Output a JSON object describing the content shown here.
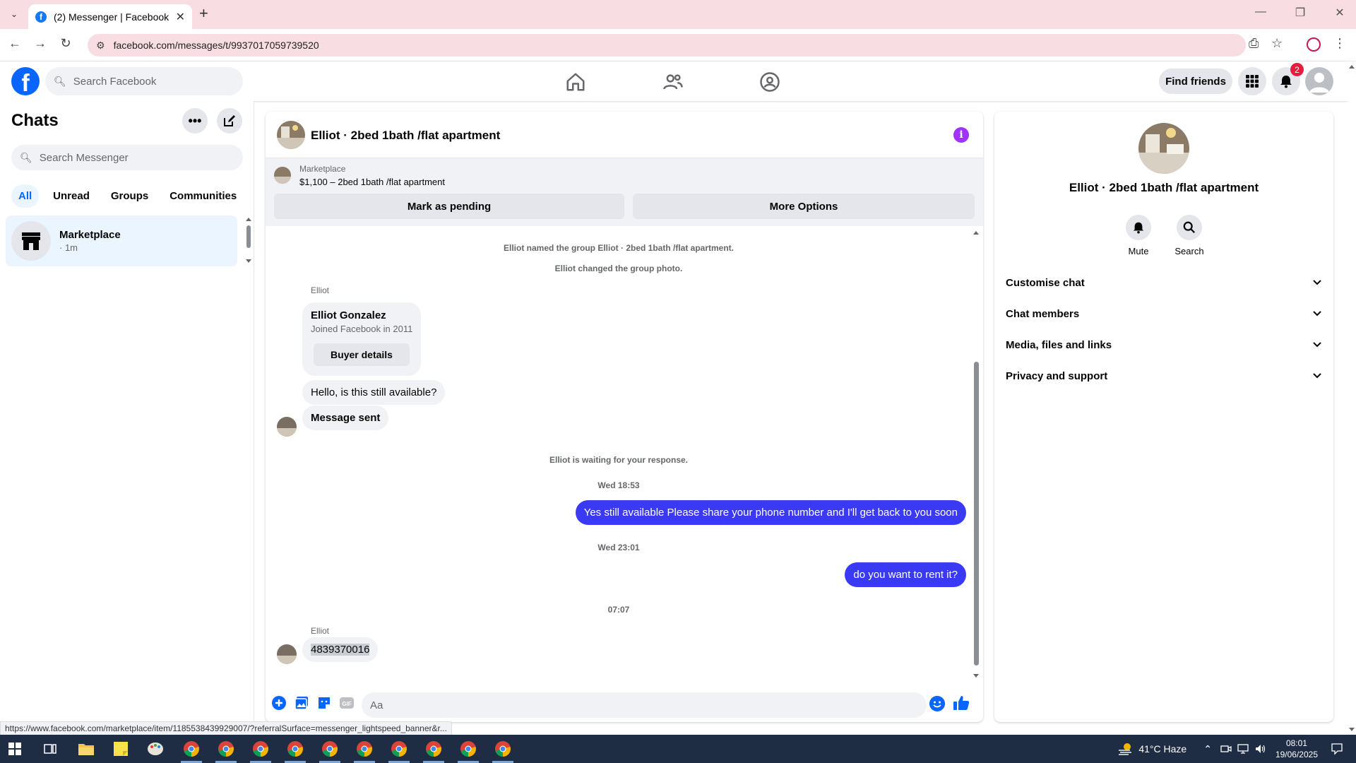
{
  "browser": {
    "tab_title": "(2) Messenger | Facebook",
    "url": "facebook.com/messages/t/9937017059739520",
    "status_link": "https://www.facebook.com/marketplace/item/1185538439929007/?referralSurface=messenger_lightspeed_banner&r..."
  },
  "header": {
    "search_placeholder": "Search Facebook",
    "find_friends_label": "Find friends",
    "notification_count": "2"
  },
  "sidebar": {
    "title": "Chats",
    "search_placeholder": "Search Messenger",
    "filters": [
      "All",
      "Unread",
      "Groups",
      "Communities"
    ],
    "active_filter": "All",
    "chats": [
      {
        "name": "Marketplace",
        "meta": "· 1m"
      }
    ]
  },
  "conversation": {
    "title": "Elliot · 2bed 1bath /flat apartment",
    "banner": {
      "label": "Marketplace",
      "price_line": "$1,100 – 2bed 1bath /flat apartment",
      "pending_label": "Mark as pending",
      "more_label": "More Options"
    },
    "system_1": "Elliot named the group Elliot · 2bed 1bath /flat apartment.",
    "system_2": "Elliot changed the group photo.",
    "sender_1": "Elliot",
    "card": {
      "name": "Elliot Gonzalez",
      "joined": "Joined Facebook in 2011",
      "button": "Buyer details"
    },
    "in_1": "Hello, is this still available?",
    "in_2": "Message sent",
    "waiting": "Elliot is waiting for your response.",
    "ts_1": "Wed 18:53",
    "out_1": "Yes still available Please share your phone number and I'll get back to you soon",
    "ts_2": "Wed 23:01",
    "out_2": "do you want to rent it?",
    "ts_3": "07:07",
    "sender_2": "Elliot",
    "in_3": "4839370016",
    "composer_placeholder": "Aa"
  },
  "right_panel": {
    "title": "Elliot · 2bed 1bath /flat apartment",
    "mute_label": "Mute",
    "search_label": "Search",
    "sections": [
      "Customise chat",
      "Chat members",
      "Media, files and links",
      "Privacy and support"
    ]
  },
  "taskbar": {
    "weather": "41°C  Haze",
    "time": "08:01",
    "date": "19/06/2025"
  },
  "colors": {
    "brand": "#0866ff",
    "outgoing_bubble": "#3a3af5",
    "info_icon": "#a033ff",
    "badge": "#e41e3f"
  }
}
